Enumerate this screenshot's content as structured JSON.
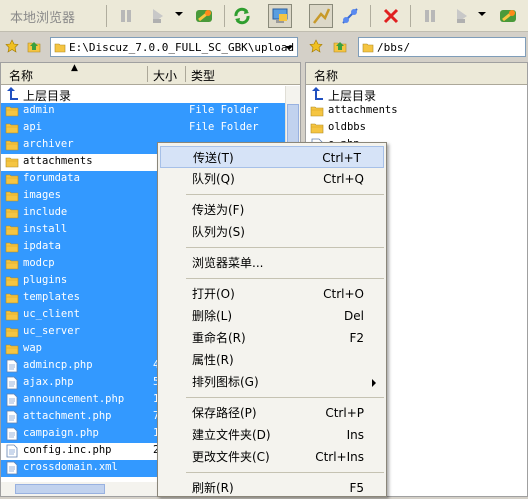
{
  "toolbar": {
    "title": "本地浏览器"
  },
  "left_path": "E:\\Discuz_7.0.0_FULL_SC_GBK\\upload",
  "right_path": "/bbs/",
  "columns": {
    "name": "名称",
    "size": "大小",
    "type": "类型"
  },
  "left_rows": [
    {
      "name": "上层目录",
      "size": "",
      "type": "",
      "kind": "up",
      "selected": false
    },
    {
      "name": "admin",
      "size": "",
      "type": "File Folder",
      "kind": "folder",
      "selected": true
    },
    {
      "name": "api",
      "size": "",
      "type": "File Folder",
      "kind": "folder",
      "selected": true
    },
    {
      "name": "archiver",
      "size": "",
      "type": "",
      "kind": "folder",
      "selected": true
    },
    {
      "name": "attachments",
      "size": "",
      "type": "",
      "kind": "folder",
      "selected": false
    },
    {
      "name": "forumdata",
      "size": "",
      "type": "",
      "kind": "folder",
      "selected": true
    },
    {
      "name": "images",
      "size": "",
      "type": "",
      "kind": "folder",
      "selected": true
    },
    {
      "name": "include",
      "size": "",
      "type": "",
      "kind": "folder",
      "selected": true
    },
    {
      "name": "install",
      "size": "",
      "type": "",
      "kind": "folder",
      "selected": true
    },
    {
      "name": "ipdata",
      "size": "",
      "type": "",
      "kind": "folder",
      "selected": true
    },
    {
      "name": "modcp",
      "size": "",
      "type": "",
      "kind": "folder",
      "selected": true
    },
    {
      "name": "plugins",
      "size": "",
      "type": "",
      "kind": "folder",
      "selected": true
    },
    {
      "name": "templates",
      "size": "",
      "type": "",
      "kind": "folder",
      "selected": true
    },
    {
      "name": "uc_client",
      "size": "",
      "type": "",
      "kind": "folder",
      "selected": true
    },
    {
      "name": "uc_server",
      "size": "",
      "type": "",
      "kind": "folder",
      "selected": true
    },
    {
      "name": "wap",
      "size": "",
      "type": "",
      "kind": "folder",
      "selected": true
    },
    {
      "name": "admincp.php",
      "size": "4",
      "type": "",
      "kind": "file",
      "selected": true
    },
    {
      "name": "ajax.php",
      "size": "5",
      "type": "",
      "kind": "file",
      "selected": true
    },
    {
      "name": "announcement.php",
      "size": "1",
      "type": "",
      "kind": "file",
      "selected": true
    },
    {
      "name": "attachment.php",
      "size": "7",
      "type": "",
      "kind": "file",
      "selected": true
    },
    {
      "name": "campaign.php",
      "size": "1",
      "type": "",
      "kind": "file",
      "selected": true
    },
    {
      "name": "config.inc.php",
      "size": "2",
      "type": "",
      "kind": "file",
      "selected": false
    },
    {
      "name": "crossdomain.xml",
      "size": "",
      "type": "",
      "kind": "file",
      "selected": true
    }
  ],
  "right_rows": [
    {
      "name": "上层目录",
      "kind": "up"
    },
    {
      "name": "attachments",
      "kind": "folder"
    },
    {
      "name": "oldbbs",
      "kind": "folder"
    },
    {
      "name": "e.php",
      "kind": "file"
    }
  ],
  "context_menu": [
    {
      "label": "传送(T)",
      "shortcut": "Ctrl+T",
      "highlight": true
    },
    {
      "label": "队列(Q)",
      "shortcut": "Ctrl+Q"
    },
    {
      "sep": true
    },
    {
      "label": "传送为(F)",
      "shortcut": ""
    },
    {
      "label": "队列为(S)",
      "shortcut": ""
    },
    {
      "sep": true
    },
    {
      "label": "浏览器菜单...",
      "shortcut": ""
    },
    {
      "sep": true
    },
    {
      "label": "打开(O)",
      "shortcut": "Ctrl+O"
    },
    {
      "label": "删除(L)",
      "shortcut": "Del"
    },
    {
      "label": "重命名(R)",
      "shortcut": "F2"
    },
    {
      "label": "属性(R)",
      "shortcut": ""
    },
    {
      "label": "排列图标(G)",
      "shortcut": "",
      "submenu": true
    },
    {
      "sep": true
    },
    {
      "label": "保存路径(P)",
      "shortcut": "Ctrl+P"
    },
    {
      "label": "建立文件夹(D)",
      "shortcut": "Ins"
    },
    {
      "label": "更改文件夹(C)",
      "shortcut": "Ctrl+Ins"
    },
    {
      "sep": true
    },
    {
      "label": "刷新(R)",
      "shortcut": "F5"
    }
  ]
}
